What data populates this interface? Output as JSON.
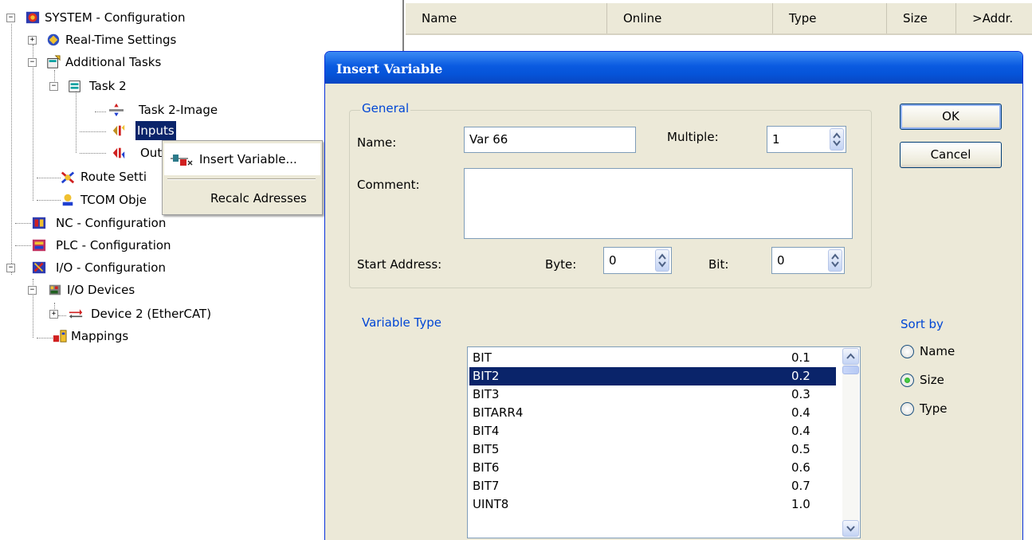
{
  "tree": {
    "items": [
      {
        "label": "SYSTEM - Configuration",
        "icon": "system-config-icon"
      },
      {
        "label": "Real-Time Settings",
        "icon": "realtime-settings-icon"
      },
      {
        "label": "Additional Tasks",
        "icon": "additional-tasks-icon"
      },
      {
        "label": "Task 2",
        "icon": "task-icon"
      },
      {
        "label": "Task 2-Image",
        "icon": "task-image-icon"
      },
      {
        "label": "Inputs",
        "icon": "inputs-icon"
      },
      {
        "label": "Out",
        "icon": "outputs-icon"
      },
      {
        "label": "Route Setti",
        "icon": "route-settings-icon"
      },
      {
        "label": "TCOM Obje",
        "icon": "tcom-objects-icon"
      },
      {
        "label": "NC - Configuration",
        "icon": "nc-config-icon"
      },
      {
        "label": "PLC - Configuration",
        "icon": "plc-config-icon"
      },
      {
        "label": "I/O - Configuration",
        "icon": "io-config-icon"
      },
      {
        "label": "I/O Devices",
        "icon": "io-devices-icon"
      },
      {
        "label": "Device 2 (EtherCAT)",
        "icon": "ethercat-device-icon"
      },
      {
        "label": "Mappings",
        "icon": "mappings-icon"
      }
    ]
  },
  "list_header": {
    "columns": [
      "Name",
      "Online",
      "Type",
      "Size",
      ">Addr."
    ]
  },
  "context_menu": {
    "items": [
      "Insert Variable...",
      "Recalc Adresses"
    ]
  },
  "dialog": {
    "title": "Insert Variable",
    "general": {
      "title": "General",
      "name_label": "Name:",
      "name_value": "Var 66",
      "multiple_label": "Multiple:",
      "multiple_value": "1",
      "comment_label": "Comment:",
      "comment_value": "",
      "start_address_label": "Start Address:",
      "byte_label": "Byte:",
      "byte_value": "0",
      "bit_label": "Bit:",
      "bit_value": "0"
    },
    "ok_label": "OK",
    "cancel_label": "Cancel",
    "variable_type": {
      "title": "Variable Type",
      "rows": [
        {
          "name": "BIT",
          "size": "0.1"
        },
        {
          "name": "BIT2",
          "size": "0.2"
        },
        {
          "name": "BIT3",
          "size": "0.3"
        },
        {
          "name": "BITARR4",
          "size": "0.4"
        },
        {
          "name": "BIT4",
          "size": "0.4"
        },
        {
          "name": "BIT5",
          "size": "0.5"
        },
        {
          "name": "BIT6",
          "size": "0.6"
        },
        {
          "name": "BIT7",
          "size": "0.7"
        },
        {
          "name": "UINT8",
          "size": "1.0"
        }
      ],
      "selected": "BIT2"
    },
    "sort_by": {
      "title": "Sort by",
      "options": [
        "Name",
        "Size",
        "Type"
      ],
      "selected": "Size"
    }
  },
  "colors": {
    "dialog_bg": "#ece9d8",
    "title_bar": "#0654d9",
    "selection": "#0a246a",
    "group_title": "#0046d5"
  }
}
